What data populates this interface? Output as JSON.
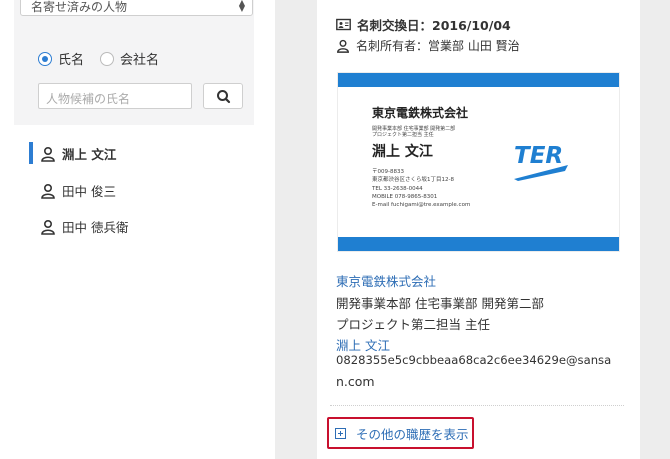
{
  "left": {
    "select_value": "名寄せ済みの人物",
    "radio_options": [
      {
        "label": "氏名",
        "selected": true
      },
      {
        "label": "会社名",
        "selected": false
      }
    ],
    "search_placeholder": "人物候補の氏名",
    "persons": [
      "淵上 文江",
      "田中 俊三",
      "田中 徳兵衛"
    ],
    "active_person_index": 0
  },
  "detail": {
    "exchange_date": "名刺交換日：2016/10/04",
    "owner": "名刺所有者：営業部 山田 賢治",
    "card": {
      "company": "東京電鉄株式会社",
      "dept_line": "開発事業本部 住宅事業部 開発第二部",
      "title_line": "プロジェクト第二担当 主任",
      "name": "淵上 文江",
      "address_lines": [
        "〒009-8833",
        "東京都渋谷区さくら坂1丁目12-8",
        "TEL 33-2638-0044",
        "MOBILE 078-9865-8301",
        "E-mail fuchigami@tre.example.com"
      ],
      "logo_text": "TER",
      "accent_color": "#1f7fd1"
    },
    "company_link": "東京電鉄株式会社",
    "department": "開発事業本部 住宅事業部 開発第二部",
    "position": "プロジェクト第二担当 主任",
    "name_link": "淵上 文江",
    "email_line1": "0828355e5c9cbbeaa68ca2c6ee34629e@sansa",
    "email_line2": "n.com",
    "more_button": "その他の職歴を表示"
  }
}
